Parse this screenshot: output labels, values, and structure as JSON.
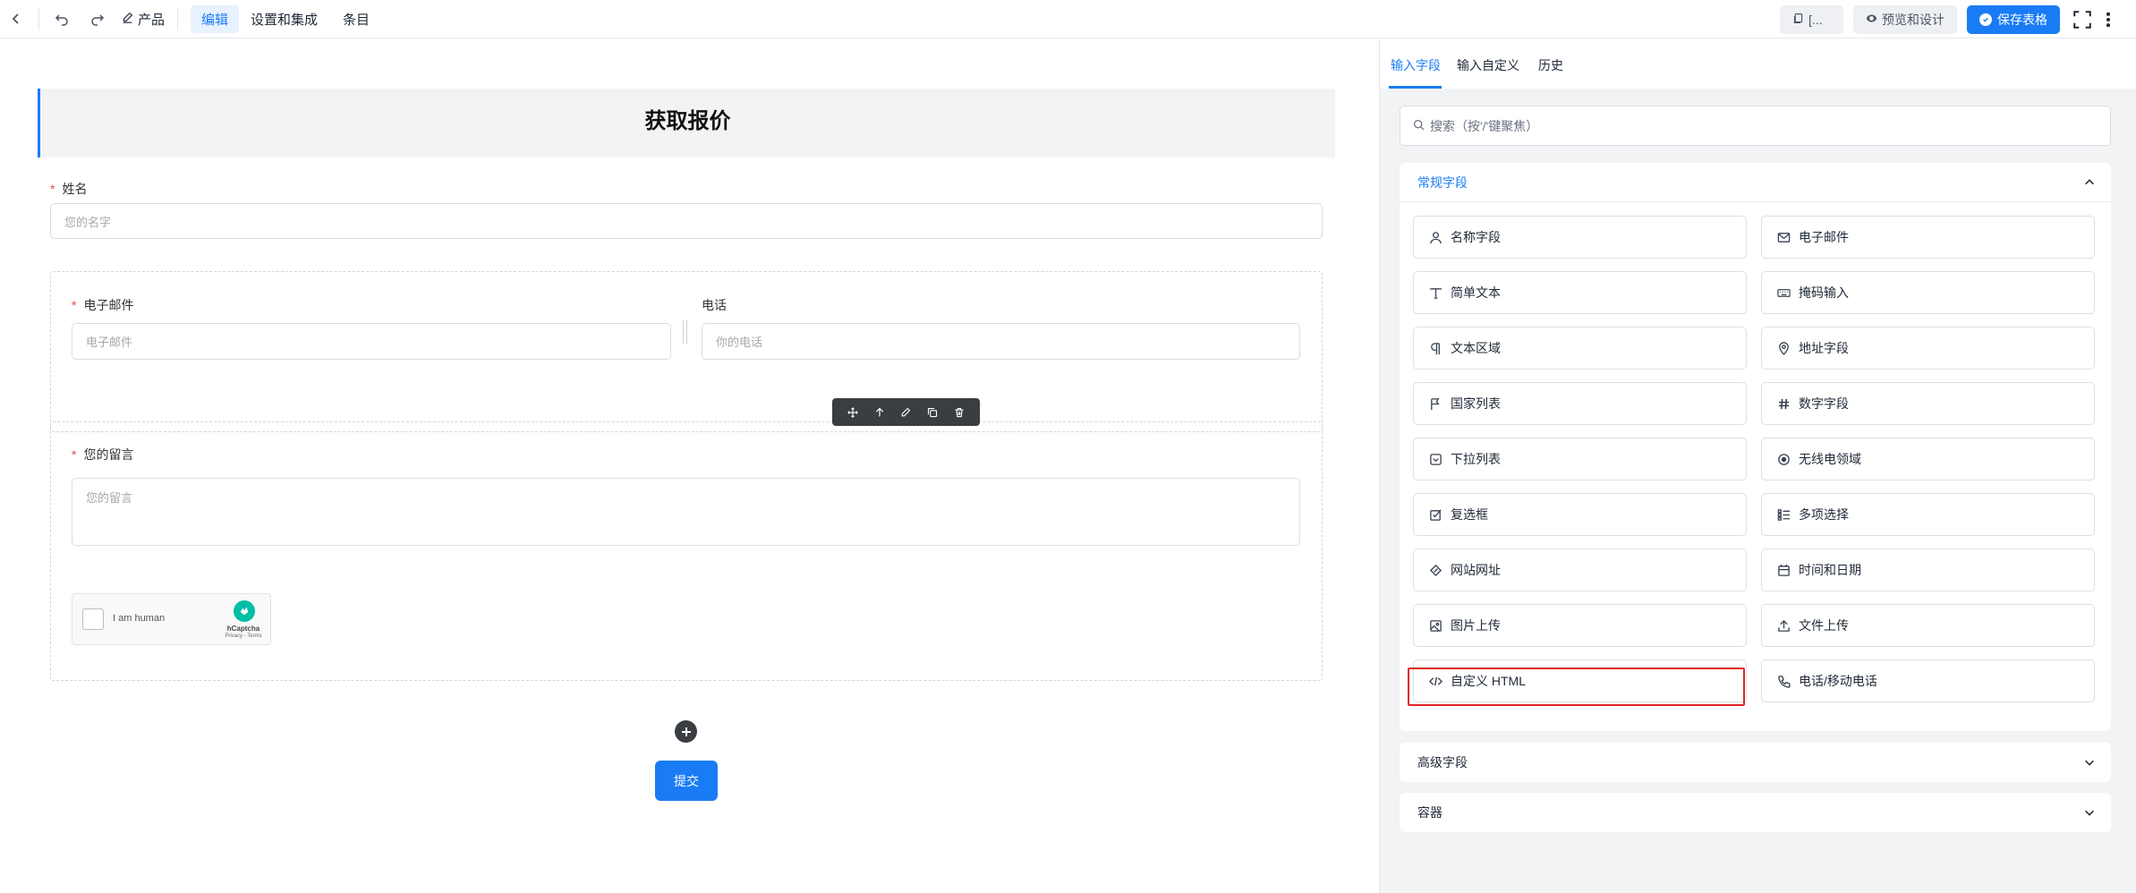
{
  "topbar": {
    "product_label": "产品",
    "tabs": [
      {
        "label": "编辑",
        "active": true
      },
      {
        "label": "设置和集成",
        "active": false
      },
      {
        "label": "条目",
        "active": false
      }
    ],
    "doc_button_label": "[...",
    "preview_label": "预览和设计",
    "save_label": "保存表格"
  },
  "form": {
    "title": "获取报价",
    "required_mark": "*",
    "name_label": "姓名",
    "name_placeholder": "您的名字",
    "email_label": "电子邮件",
    "email_placeholder": "电子邮件",
    "phone_label": "电话",
    "phone_placeholder": "你的电话",
    "message_label": "您的留言",
    "message_placeholder": "您的留言",
    "captcha": {
      "text": "I am human",
      "brand": "hCaptcha",
      "links": "Privacy - Terms"
    },
    "submit_label": "提交"
  },
  "panel": {
    "tabs": [
      {
        "label": "输入字段",
        "active": true
      },
      {
        "label": "输入自定义",
        "active": false
      },
      {
        "label": "历史",
        "active": false
      }
    ],
    "search_placeholder": "搜索（按'/'键聚焦）",
    "groups": [
      {
        "label": "常规字段",
        "expanded": true
      },
      {
        "label": "高级字段",
        "expanded": false
      },
      {
        "label": "容器",
        "expanded": false
      }
    ],
    "fields": [
      {
        "label": "名称字段",
        "icon": "user-icon"
      },
      {
        "label": "电子邮件",
        "icon": "mail-icon"
      },
      {
        "label": "简单文本",
        "icon": "text-icon"
      },
      {
        "label": "掩码输入",
        "icon": "keyboard-icon"
      },
      {
        "label": "文本区域",
        "icon": "paragraph-icon"
      },
      {
        "label": "地址字段",
        "icon": "map-pin-icon"
      },
      {
        "label": "国家列表",
        "icon": "flag-icon"
      },
      {
        "label": "数字字段",
        "icon": "hash-icon"
      },
      {
        "label": "下拉列表",
        "icon": "dropdown-icon"
      },
      {
        "label": "无线电领域",
        "icon": "radio-icon"
      },
      {
        "label": "复选框",
        "icon": "checkbox-icon"
      },
      {
        "label": "多项选择",
        "icon": "list-icon"
      },
      {
        "label": "网站网址",
        "icon": "link-icon"
      },
      {
        "label": "时间和日期",
        "icon": "calendar-icon"
      },
      {
        "label": "图片上传",
        "icon": "image-icon"
      },
      {
        "label": "文件上传",
        "icon": "upload-icon"
      },
      {
        "label": "自定义 HTML",
        "icon": "code-icon"
      },
      {
        "label": "电话/移动电话",
        "icon": "phone-icon"
      }
    ]
  },
  "colors": {
    "accent": "#1a7cf5",
    "highlight": "#e02424",
    "panel_bg": "#f2f3f5"
  }
}
